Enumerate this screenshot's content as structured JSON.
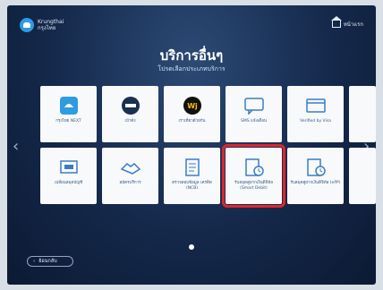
{
  "header": {
    "logo_text": "Krungthai",
    "logo_sub": "กรุงไทย",
    "home_label": "หน้าแรก"
  },
  "page": {
    "title": "บริการอื่นๆ",
    "subtitle": "โปรดเลือกประเภทบริการ"
  },
  "tiles": [
    {
      "label": "กรุงไทย NEXT",
      "icon": "krungthai-next-icon"
    },
    {
      "label": "เป๋าตัง",
      "icon": "paotang-icon"
    },
    {
      "label": "เราเที่ยวด้วยกัน",
      "icon": "we-travel-icon"
    },
    {
      "label": "SMS แจ้งเตือน",
      "icon": "sms-icon"
    },
    {
      "label": "Verified by Visa",
      "icon": "verified-visa-icon"
    },
    {
      "label": "เปลี่ยนสมุดบัญชี",
      "icon": "passbook-icon"
    },
    {
      "label": "สมัครบริการ",
      "icon": "handshake-icon"
    },
    {
      "label": "ตรวจสอบข้อมูล เครดิต (NCB)",
      "icon": "document-icon"
    },
    {
      "label": "รับสมุดคู่ฝากเงินดิจิทัล (Smart Debit)",
      "icon": "digital-book-icon"
    },
    {
      "label": "รับสมุดคู่ฝากเงินดิจิทัล (ePP)",
      "icon": "digital-book-clock-icon"
    }
  ],
  "nav": {
    "back_label": "ย้อนกลับ",
    "prev_arrow": "‹",
    "next_arrow": "›"
  },
  "colors": {
    "accent": "#e0242e",
    "background": "#14284a",
    "tile": "#f7f9fb"
  }
}
